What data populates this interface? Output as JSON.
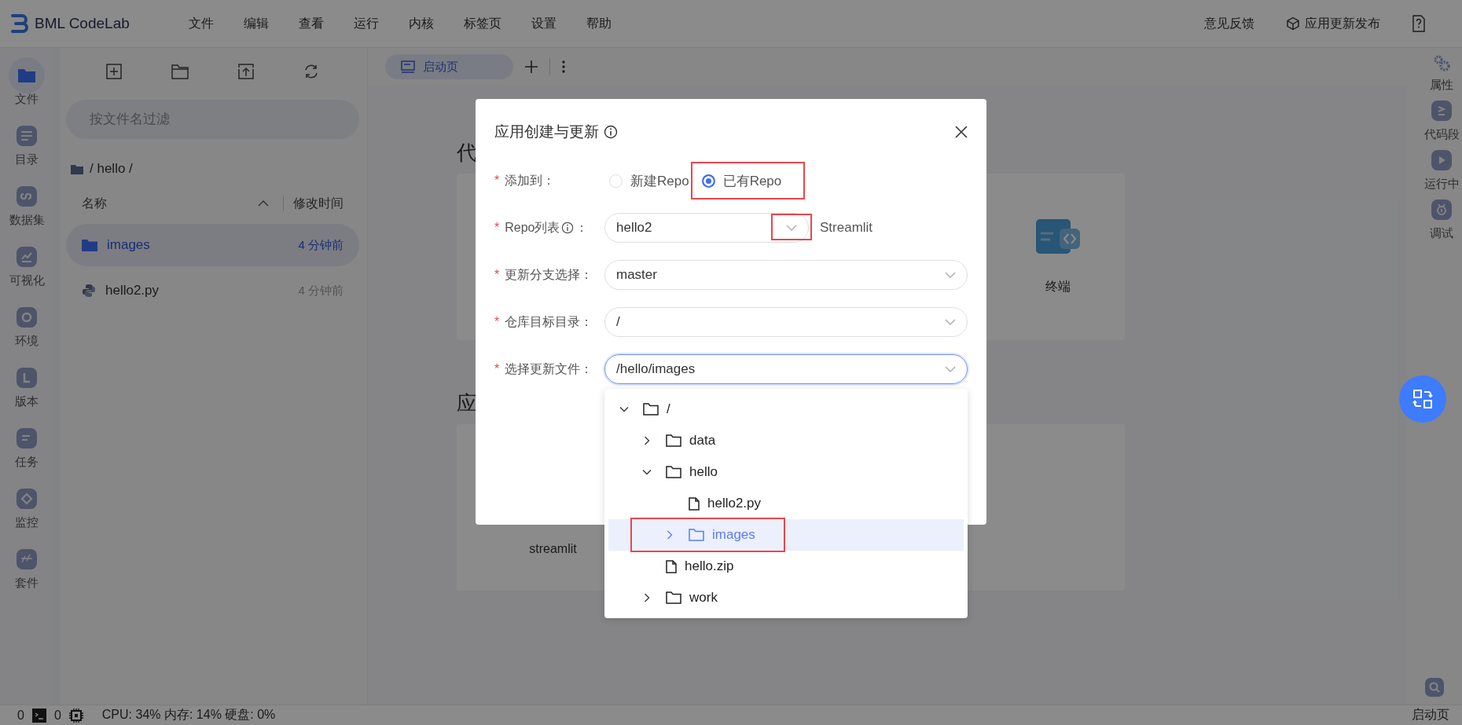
{
  "app": {
    "logo": "BML CodeLab"
  },
  "menu": [
    "文件",
    "编辑",
    "查看",
    "运行",
    "内核",
    "标签页",
    "设置",
    "帮助"
  ],
  "header_actions": [
    {
      "kind": "text",
      "label": "意见反馈"
    },
    {
      "kind": "release",
      "label": "应用更新发布"
    },
    {
      "kind": "help"
    }
  ],
  "left_rail": [
    {
      "label": "文件",
      "kind": "folder",
      "selected": true
    },
    {
      "label": "目录",
      "kind": "list",
      "selected": false
    },
    {
      "label": "数据集",
      "kind": "dataset",
      "selected": false
    },
    {
      "label": "可视化",
      "kind": "chart",
      "selected": false
    },
    {
      "label": "环境",
      "kind": "ring",
      "selected": false
    },
    {
      "label": "版本",
      "kind": "version",
      "selected": false
    },
    {
      "label": "任务",
      "kind": "task",
      "selected": false
    },
    {
      "label": "监控",
      "kind": "monitor",
      "selected": false
    },
    {
      "label": "套件",
      "kind": "suite",
      "selected": false
    }
  ],
  "file_panel": {
    "filter_placeholder": "按文件名过滤",
    "breadcrumb": "/ hello /",
    "columns": [
      "名称",
      "修改时间"
    ],
    "rows": [
      {
        "name": "images",
        "kind": "folder",
        "modified": "4 分钟前",
        "selected": true
      },
      {
        "name": "hello2.py",
        "kind": "python",
        "modified": "4 分钟前",
        "selected": false
      }
    ]
  },
  "tabs": [
    {
      "label": "启动页",
      "selected": true
    }
  ],
  "launcher": [
    {
      "heading": "代",
      "cards": [
        {
          "label": "终端",
          "kind": "terminal"
        }
      ]
    },
    {
      "heading": "应",
      "cards": [
        {
          "label": "streamlit",
          "kind": "plain"
        }
      ]
    }
  ],
  "right_rail": [
    {
      "label": "属性",
      "kind": "gears"
    },
    {
      "label": "代码段",
      "kind": "snippet"
    },
    {
      "label": "运行中",
      "kind": "running"
    },
    {
      "label": "调试",
      "kind": "debug"
    }
  ],
  "status_bar": {
    "kernels": "0",
    "terminals": "0",
    "resources": "CPU: 34% 内存: 14% 硬盘: 0%",
    "right": "启动页"
  },
  "modal": {
    "title": "应用创建与更新",
    "fields": [
      {
        "kind": "radio",
        "label": "添加到：",
        "required_mark": "*",
        "options": [
          {
            "label": "新建Repo",
            "selected": false,
            "highlighted": false
          },
          {
            "label": "已有Repo",
            "selected": true,
            "highlighted": true
          }
        ]
      },
      {
        "kind": "select",
        "label": "Repo列表",
        "info": true,
        "suffix": "：",
        "required_mark": "*",
        "value": "hello2",
        "arrow_highlighted": true,
        "note": "Streamlit",
        "focused": false
      },
      {
        "kind": "select",
        "label": "更新分支选择：",
        "required_mark": "*",
        "value": "master",
        "focused": false
      },
      {
        "kind": "select",
        "label": "仓库目标目录：",
        "required_mark": "*",
        "value": "/",
        "focused": false
      },
      {
        "kind": "tree_select",
        "label": "选择更新文件：",
        "required_mark": "*",
        "value": "/hello/images",
        "focused": true,
        "tree": [
          {
            "name": "/",
            "kind": "folder",
            "expanded": true,
            "selected": false,
            "highlighted": false,
            "children": [
              {
                "name": "data",
                "kind": "folder",
                "expanded": false,
                "selected": false,
                "highlighted": false
              },
              {
                "name": "hello",
                "kind": "folder",
                "expanded": true,
                "selected": false,
                "highlighted": false,
                "children": [
                  {
                    "name": "hello2.py",
                    "kind": "file",
                    "selected": false,
                    "highlighted": false
                  },
                  {
                    "name": "images",
                    "kind": "folder",
                    "expanded": false,
                    "selected": true,
                    "highlighted": true
                  }
                ]
              },
              {
                "name": "hello.zip",
                "kind": "file",
                "selected": false,
                "highlighted": false
              },
              {
                "name": "work",
                "kind": "folder",
                "expanded": false,
                "selected": false,
                "highlighted": false
              }
            ]
          }
        ]
      }
    ]
  }
}
